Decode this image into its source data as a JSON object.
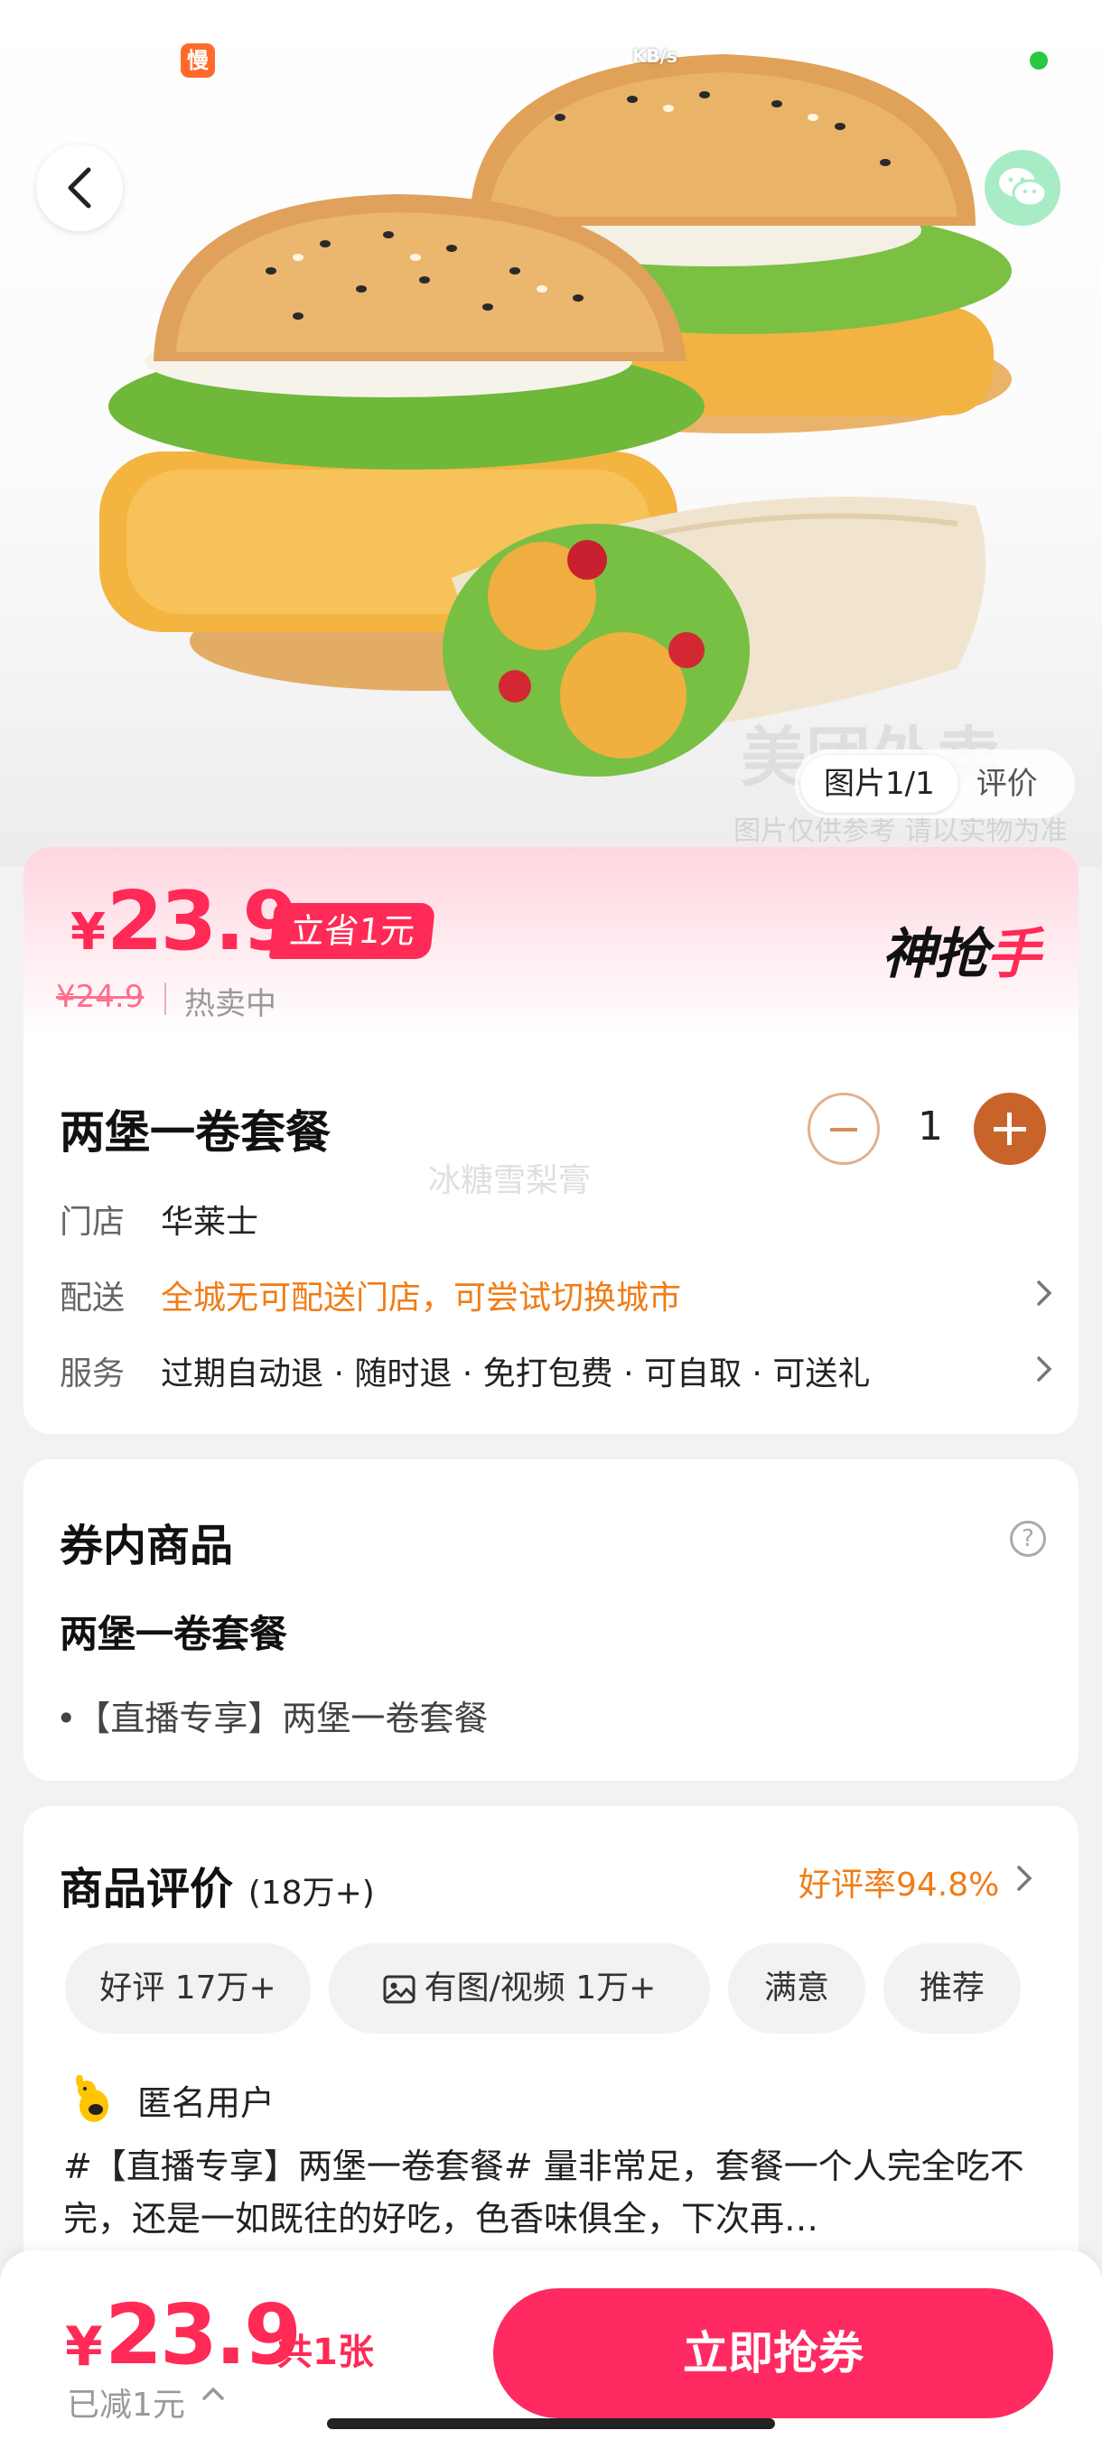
{
  "status_bar": {
    "app_badge": "慢",
    "speed": "KB/s"
  },
  "hero": {
    "image_counter": "图片1/1",
    "review_tab": "评价",
    "watermark_brand": "美团外卖",
    "watermark_note": "图片仅供参考 请以实物为准"
  },
  "price": {
    "yen": "¥",
    "current": "23.9",
    "save_badge": "立省1元",
    "original": "¥24.9",
    "status": "热卖中",
    "brand_logo_main": "神抢",
    "brand_logo_end": "手"
  },
  "product": {
    "title": "两堡一卷套餐",
    "quantity": "1",
    "watermark": "冰糖雪梨膏",
    "rows": [
      {
        "label": "门店",
        "value": "华莱士"
      },
      {
        "label": "配送",
        "value": "全城无可配送门店，可尝试切换城市"
      },
      {
        "label": "服务",
        "value": "过期自动退 · 随时退 · 免打包费 · 可自取 · 可送礼"
      }
    ]
  },
  "coupon": {
    "title": "券内商品",
    "help": "?",
    "item_name": "两堡一卷套餐",
    "item_detail": "•【直播专享】两堡一卷套餐"
  },
  "reviews": {
    "title": "商品评价",
    "count": "(18万+)",
    "good_rate": "好评率94.8%",
    "chips": [
      "好评 17万+",
      "有图/视频 1万+",
      "满意",
      "推荐"
    ],
    "reviewer": "匿名用户",
    "text": "#【直播专享】两堡一卷套餐# 量非常足，套餐一个人完全吃不完，还是一如既往的好吃，色香味俱全，下次再…"
  },
  "bottom_bar": {
    "yen": "¥",
    "price": "23.9",
    "count": "共1张",
    "reduced": "已减1元",
    "buy_button": "立即抢券"
  },
  "colors": {
    "accent_red": "#ff2a55",
    "orange": "#f07c16",
    "stepper_brown": "#c8632a"
  }
}
